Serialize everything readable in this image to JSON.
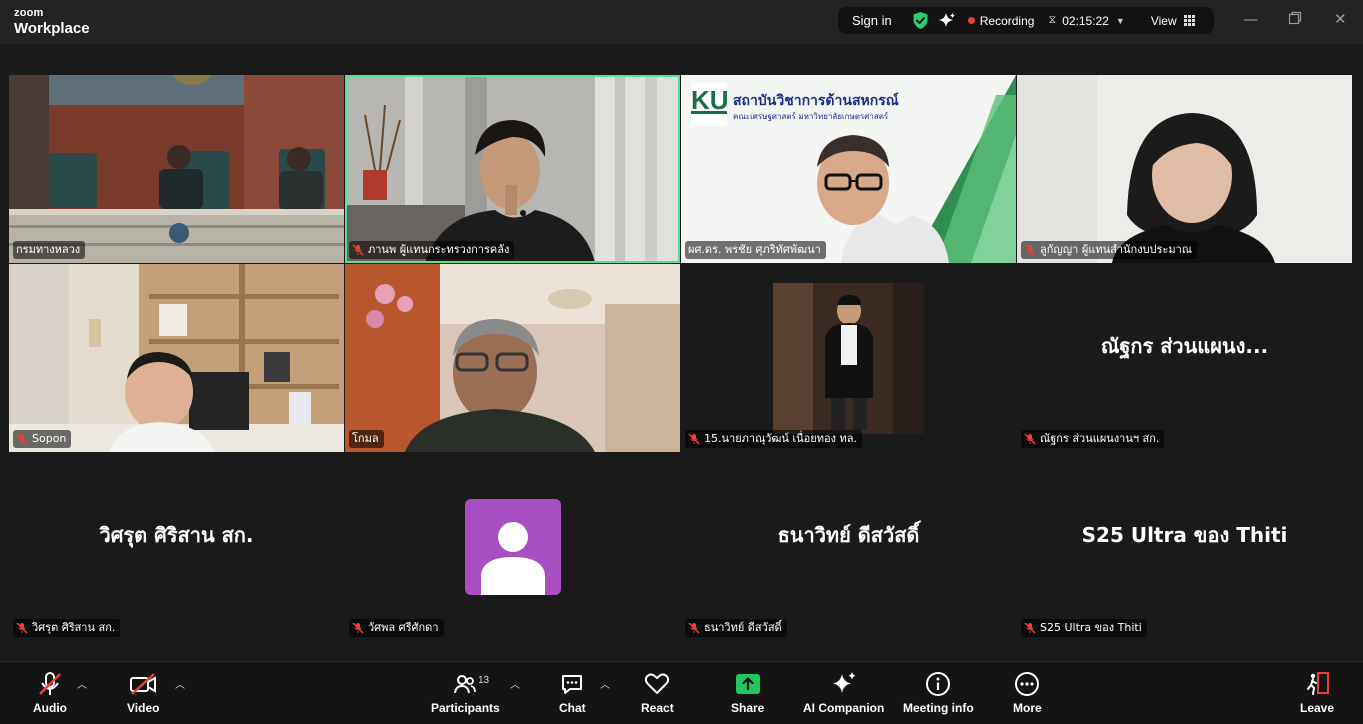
{
  "app": {
    "logo_line1": "zoom",
    "logo_line2": "Workplace"
  },
  "topbar": {
    "sign_in": "Sign in",
    "recording": "Recording",
    "timer": "02:15:22",
    "view": "View"
  },
  "colors": {
    "active_speaker": "#4fe39a",
    "muted_mic": "#e8423a",
    "avatar_bg": "#a84fc4",
    "shield": "#2ecc71",
    "share_green": "#22c55e"
  },
  "participants": [
    {
      "name": "กรมทางหลวง",
      "muted": false,
      "video": true
    },
    {
      "name": "ภานพ ผู้แทนกระทรวงการคลัง",
      "muted": true,
      "video": true,
      "active": true
    },
    {
      "name": "ผศ.ดร. พรชัย ศุภริทัศพัฒนา",
      "muted": false,
      "video": true
    },
    {
      "name": "ลูกัญญา ผู้แทนสำนักงบประมาณ",
      "muted": true,
      "video": true
    },
    {
      "name": "Sopon",
      "muted": true,
      "video": true
    },
    {
      "name": "โกมล",
      "muted": false,
      "video": true
    },
    {
      "name": "15.นายภาณุวัฒน์ เนื่อยทอง ทล.",
      "muted": true,
      "video": false,
      "photo": true
    },
    {
      "name": "ณัฐกร  ส่วนแผนงานฯ สก.",
      "display": "ณัฐกร  ส่วนแผนง...",
      "muted": true,
      "video": false
    },
    {
      "name": "วิศรุต ศิริสาน สก.",
      "display": "วิศรุต ศิริสาน สก.",
      "muted": true,
      "video": false
    },
    {
      "name": "วัศพล ศรีศักดา",
      "muted": true,
      "video": false,
      "avatar": true
    },
    {
      "name": "ธนาวิทย์ ดีสวัสดิ์",
      "display": "ธนาวิทย์ ดีสวัสดิ์",
      "muted": true,
      "video": false
    },
    {
      "name": "S25 Ultra ของ Thiti",
      "display": "S25 Ultra ของ Thiti",
      "muted": true,
      "video": false
    }
  ],
  "slide": {
    "logo": "KU",
    "title": "สถาบันวิชาการด้านสหกรณ์",
    "subtitle": "คณะเศรษฐศาสตร์ มหาวิทยาลัยเกษตรศาสตร์"
  },
  "toolbar": {
    "audio": "Audio",
    "video": "Video",
    "participants": "Participants",
    "participants_count": "13",
    "chat": "Chat",
    "react": "React",
    "share": "Share",
    "ai_companion": "AI Companion",
    "meeting_info": "Meeting info",
    "more": "More",
    "leave": "Leave"
  }
}
